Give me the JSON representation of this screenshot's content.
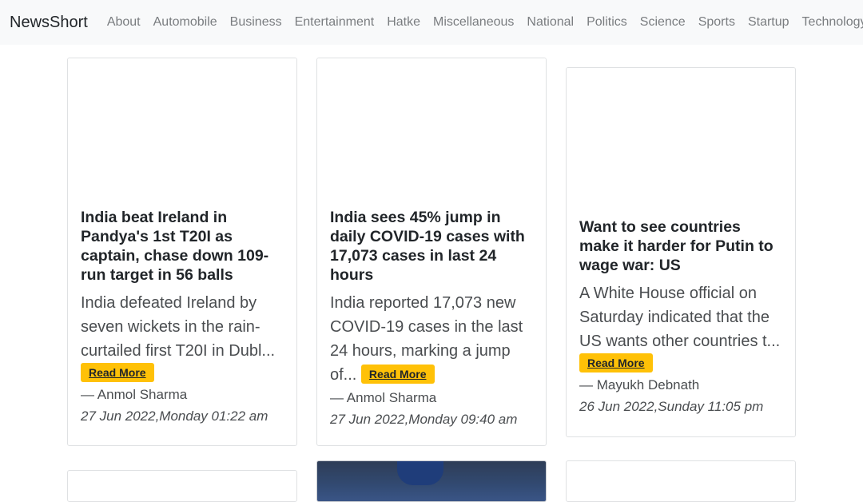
{
  "navbar": {
    "brand": "NewsShort",
    "links": [
      "About",
      "Automobile",
      "Business",
      "Entertainment",
      "Hatke",
      "Miscellaneous",
      "National",
      "Politics",
      "Science",
      "Sports",
      "Startup",
      "Technology"
    ]
  },
  "cards": [
    {
      "title": "India beat Ireland in Pandya's 1st T20I as captain, chase down 109-run target in 56 balls",
      "excerpt": "India defeated Ireland by seven wickets in the rain-curtailed first T20I in Dubl...",
      "read_more": "Read More",
      "author": "— Anmol Sharma",
      "date": "27 Jun 2022,Monday 01:22 am"
    },
    {
      "title": "India sees 45% jump in daily COVID-19 cases with 17,073 cases in last 24 hours",
      "excerpt": "India reported 17,073 new COVID-19 cases in the last 24 hours, marking a jump of...",
      "read_more": "Read More",
      "author": "— Anmol Sharma",
      "date": "27 Jun 2022,Monday 09:40 am"
    },
    {
      "title": "Want to see countries make it harder for Putin to wage war: US",
      "excerpt": "A White House official on Saturday indicated that the US wants other countries t...",
      "read_more": "Read More",
      "author": "— Mayukh Debnath",
      "date": "26 Jun 2022,Sunday 11:05 pm"
    }
  ]
}
